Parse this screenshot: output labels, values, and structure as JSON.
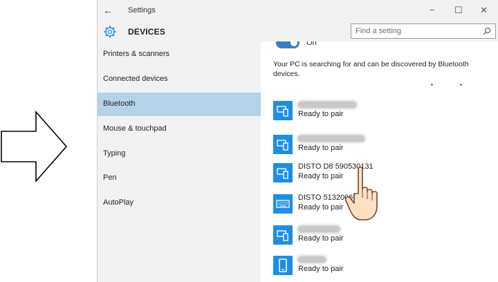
{
  "window": {
    "back_glyph": "←",
    "title": "Settings",
    "controls": {
      "minimize": "−",
      "maximize": "☐",
      "close": "✕"
    }
  },
  "header": {
    "section_title": "DEVICES",
    "search_placeholder": "Find a setting"
  },
  "sidebar": {
    "items": [
      {
        "label": "Printers & scanners",
        "active": false
      },
      {
        "label": "Connected devices",
        "active": false
      },
      {
        "label": "Bluetooth",
        "active": true
      },
      {
        "label": "Mouse & touchpad",
        "active": false
      },
      {
        "label": "Typing",
        "active": false
      },
      {
        "label": "Pen",
        "active": false
      },
      {
        "label": "AutoPlay",
        "active": false
      }
    ]
  },
  "bluetooth": {
    "toggle_label": "On",
    "toggle_state": "on",
    "status_text": "Your PC is searching for and can be discovered by Bluetooth devices.",
    "devices": [
      {
        "name": "",
        "name_obscured": true,
        "status": "Ready to pair",
        "icon": "phone-pc-icon"
      },
      {
        "name": "",
        "name_obscured": true,
        "status": "Ready to pair",
        "icon": "phone-pc-icon"
      },
      {
        "name": "DISTO D8 590530131",
        "name_obscured": false,
        "status": "Ready to pair",
        "icon": "phone-pc-icon"
      },
      {
        "name": "DISTO 51320069",
        "name_obscured": false,
        "status": "Ready to pair",
        "icon": "keyboard-icon"
      },
      {
        "name": "",
        "name_obscured": true,
        "status": "Ready to pair",
        "icon": "phone-pc-icon"
      },
      {
        "name": "",
        "name_obscured": true,
        "status": "Ready to pair",
        "icon": "phone-icon"
      }
    ]
  },
  "colors": {
    "accent": "#1d8ee6",
    "selected_nav": "#b3d3e8",
    "toggle": "#3a7bc8",
    "chrome": "#f2f2f2"
  }
}
